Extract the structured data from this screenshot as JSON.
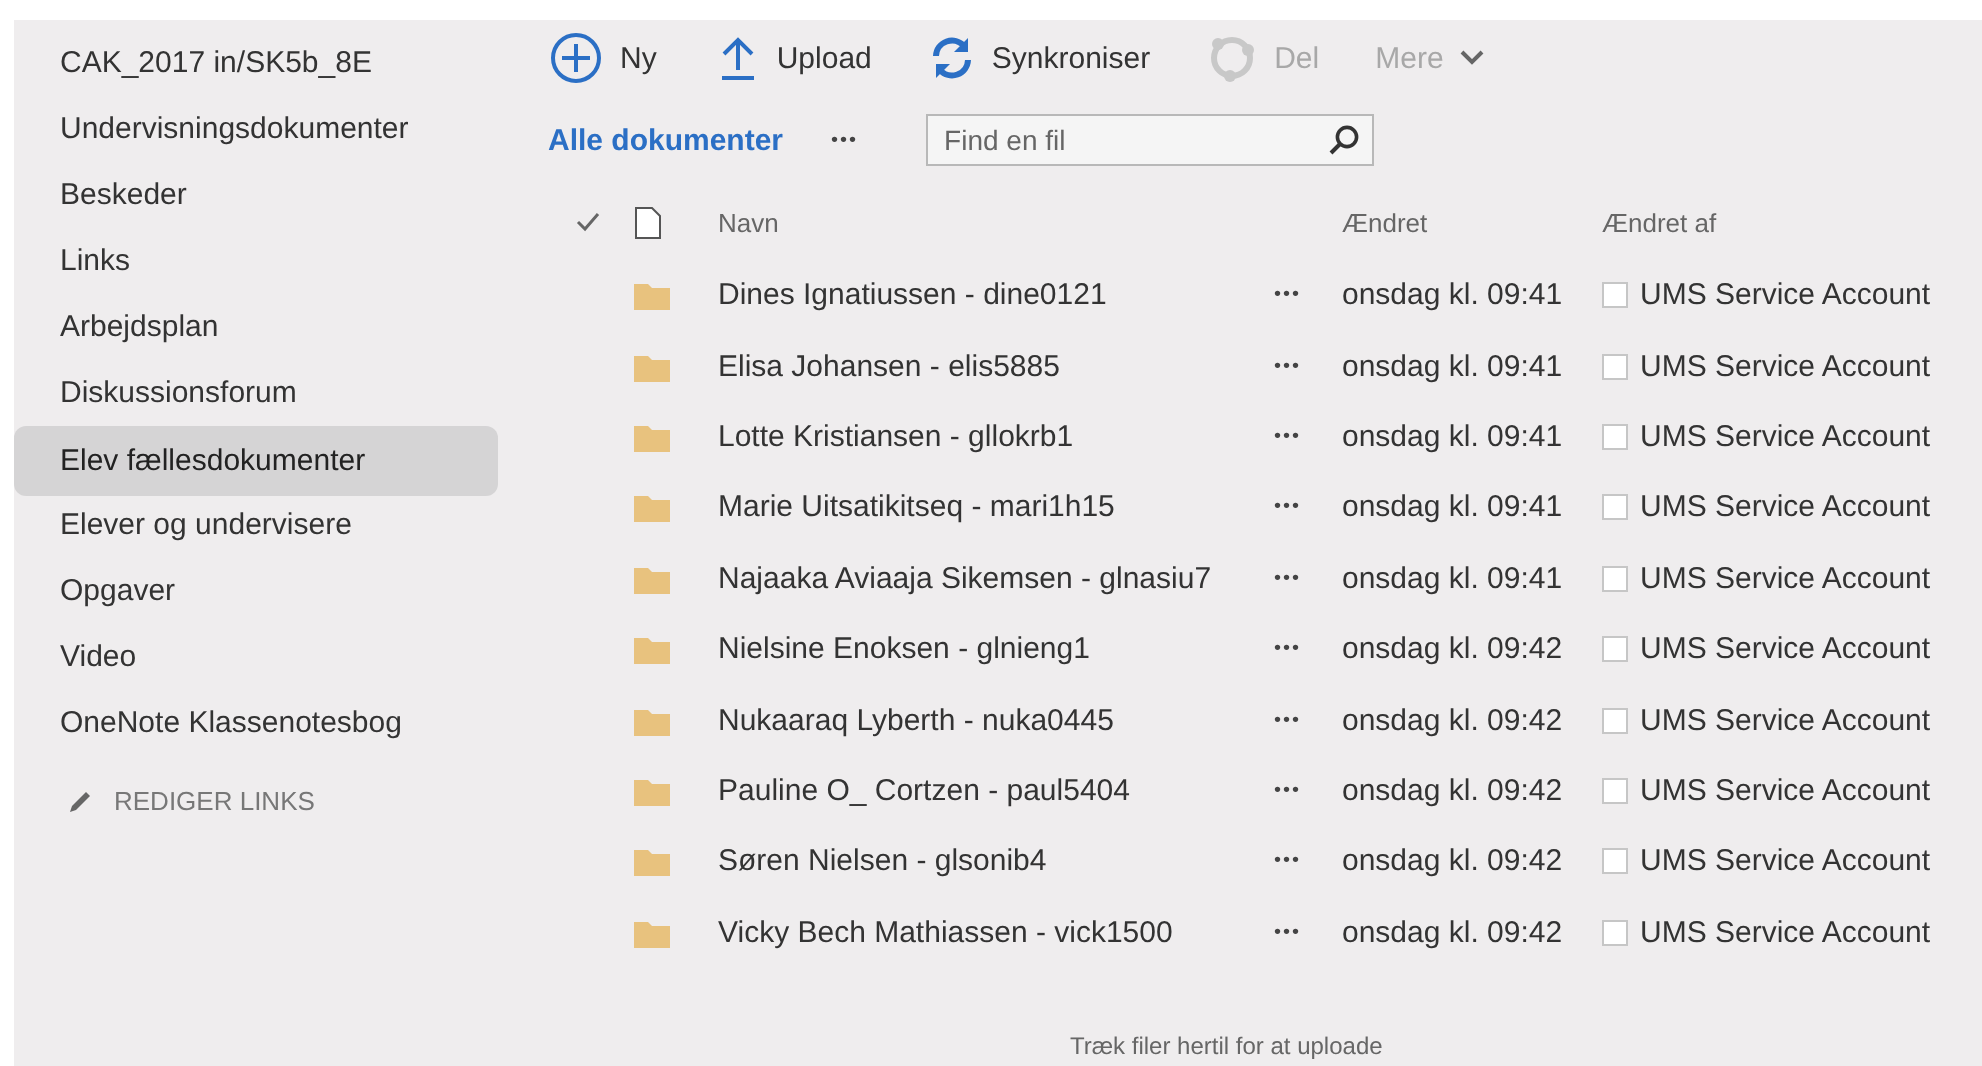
{
  "sidebar": {
    "items": [
      {
        "label": "CAK_2017 in/SK5b_8E",
        "selected": false
      },
      {
        "label": "Undervisningsdokumenter",
        "selected": false
      },
      {
        "label": "Beskeder",
        "selected": false
      },
      {
        "label": "Links",
        "selected": false
      },
      {
        "label": "Arbejdsplan",
        "selected": false
      },
      {
        "label": "Diskussionsforum",
        "selected": false
      },
      {
        "label": "Elev fællesdokumenter",
        "selected": true
      },
      {
        "label": "Elever og undervisere",
        "selected": false
      },
      {
        "label": "Opgaver",
        "selected": false
      },
      {
        "label": "Video",
        "selected": false
      },
      {
        "label": "OneNote Klassenotesbog",
        "selected": false
      }
    ],
    "edit_link": "REDIGER LINKS"
  },
  "toolbar": [
    {
      "kind": "new",
      "label": "Ny",
      "disabled": false
    },
    {
      "kind": "upload",
      "label": "Upload",
      "disabled": false
    },
    {
      "kind": "sync",
      "label": "Synkroniser",
      "disabled": false
    },
    {
      "kind": "share",
      "label": "Del",
      "disabled": true
    },
    {
      "kind": "more",
      "label": "Mere",
      "disabled": true
    }
  ],
  "view": {
    "label": "Alle dokumenter",
    "more": "•••"
  },
  "search": {
    "placeholder": "Find en fil"
  },
  "table": {
    "columns": [
      "Navn",
      "Ændret",
      "Ændret af"
    ],
    "rows": [
      {
        "name": "Dines Ignatiussen - dine0121",
        "menu": "•••",
        "modified": "onsdag kl. 09:41",
        "modified_by": "UMS Service Account",
        "checked": false
      },
      {
        "name": "Elisa Johansen - elis5885",
        "menu": "•••",
        "modified": "onsdag kl. 09:41",
        "modified_by": "UMS Service Account",
        "checked": false
      },
      {
        "name": "Lotte Kristiansen - gllokrb1",
        "menu": "•••",
        "modified": "onsdag kl. 09:41",
        "modified_by": "UMS Service Account",
        "checked": false
      },
      {
        "name": "Marie Uitsatikitseq - mari1h15",
        "menu": "•••",
        "modified": "onsdag kl. 09:41",
        "modified_by": "UMS Service Account",
        "checked": false
      },
      {
        "name": "Najaaka Aviaaja Sikemsen - glnasiu7",
        "menu": "•••",
        "modified": "onsdag kl. 09:41",
        "modified_by": "UMS Service Account",
        "checked": false
      },
      {
        "name": "Nielsine Enoksen - glnieng1",
        "menu": "•••",
        "modified": "onsdag kl. 09:42",
        "modified_by": "UMS Service Account",
        "checked": false
      },
      {
        "name": "Nukaaraq Lyberth - nuka0445",
        "menu": "•••",
        "modified": "onsdag kl. 09:42",
        "modified_by": "UMS Service Account",
        "checked": false
      },
      {
        "name": "Pauline O_ Cortzen - paul5404",
        "menu": "•••",
        "modified": "onsdag kl. 09:42",
        "modified_by": "UMS Service Account",
        "checked": false
      },
      {
        "name": "Søren Nielsen - glsonib4",
        "menu": "•••",
        "modified": "onsdag kl. 09:42",
        "modified_by": "UMS Service Account",
        "checked": false
      },
      {
        "name": "Vicky Bech Mathiassen - vick1500",
        "menu": "•••",
        "modified": "onsdag kl. 09:42",
        "modified_by": "UMS Service Account",
        "checked": false
      }
    ]
  },
  "drop_hint": "Træk filer hertil for at uploade"
}
